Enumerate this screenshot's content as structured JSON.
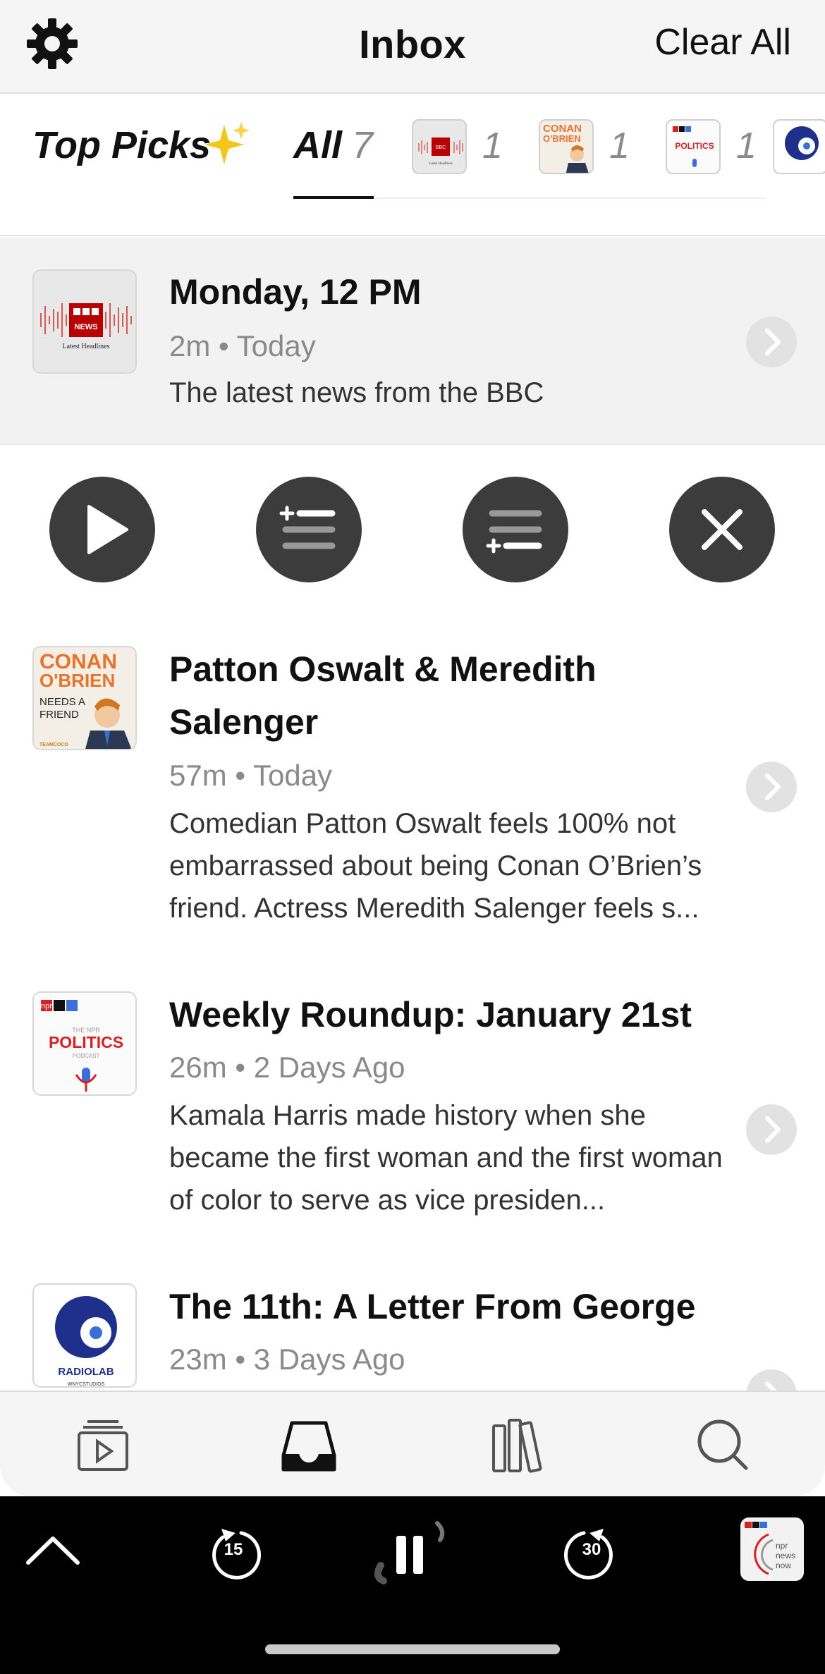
{
  "header": {
    "title": "Inbox",
    "clear_all": "Clear All"
  },
  "filters": {
    "top_picks": "Top Picks",
    "all_label": "All",
    "all_count": "7",
    "podcasts": [
      {
        "name": "BBC News Latest Headlines",
        "count": "1"
      },
      {
        "name": "Conan O'Brien Needs A Friend",
        "count": "1"
      },
      {
        "name": "The NPR Politics Podcast",
        "count": "1"
      },
      {
        "name": "Radiolab",
        "count": ""
      }
    ]
  },
  "art_text": {
    "bbc_badge": "BBC NEWS",
    "bbc_sub": "Latest Headlines",
    "conan_line1": "CONAN",
    "conan_line2": "O'BRIEN",
    "conan_line3": "NEEDS A",
    "conan_line4": "FRIEND",
    "conan_brand": "TEAMCOCO",
    "npr_logo": "npr",
    "politics_small": "THE NPR",
    "politics_big": "POLITICS",
    "politics_podcast": "PODCAST",
    "radiolab_name": "RADIOLAB",
    "radiolab_studio": "WNYCSTUDIOS",
    "newsnow": "news now"
  },
  "episodes": [
    {
      "title": "Monday, 12 PM",
      "meta": "2m • Today",
      "desc": "The latest news from the BBC"
    },
    {
      "title": "Patton Oswalt & Meredith Salenger",
      "meta": "57m • Today",
      "desc": "Comedian Patton Oswalt feels 100% not embarrassed about being Conan O’Brien’s friend. Actress Meredith Salenger feels s..."
    },
    {
      "title": "Weekly Roundup: January 21st",
      "meta": "26m • 2 Days Ago",
      "desc": "Kamala Harris made history when she became the first woman and the first woman of color to serve as vice presiden..."
    },
    {
      "title": "The 11th: A Letter From George",
      "meta": "23m • 3 Days Ago",
      "desc": ""
    }
  ],
  "player": {
    "rewind_seconds": "15",
    "forward_seconds": "30"
  },
  "colors": {
    "accent": "#3c3c3c",
    "bbc_red": "#b80000",
    "conan_orange": "#e8742b",
    "npr_red": "#d62021",
    "radiolab_blue": "#1f2f8c"
  }
}
